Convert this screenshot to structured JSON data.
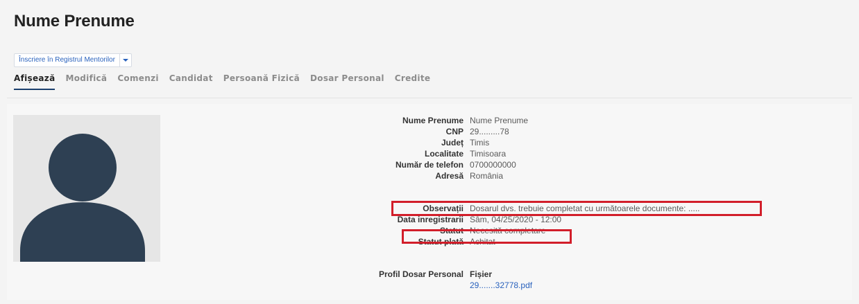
{
  "page": {
    "title": "Nume Prenume"
  },
  "actions": {
    "primary_label": "Înscriere în Registrul Mentorilor"
  },
  "tabs": [
    {
      "label": "Afișează",
      "active": true
    },
    {
      "label": "Modifică",
      "active": false
    },
    {
      "label": "Comenzi",
      "active": false
    },
    {
      "label": "Candidat",
      "active": false
    },
    {
      "label": "Persoană Fizică",
      "active": false
    },
    {
      "label": "Dosar Personal",
      "active": false
    },
    {
      "label": "Credite",
      "active": false
    }
  ],
  "profile": {
    "avatar_icon": "user-silhouette-icon",
    "fields": [
      {
        "label": "Nume Prenume",
        "value": "Nume Prenume"
      },
      {
        "label": "CNP",
        "value": "29.........78"
      },
      {
        "label": "Județ",
        "value": "Timis"
      },
      {
        "label": "Localitate",
        "value": "Timisoara"
      },
      {
        "label": "Număr de telefon",
        "value": "0700000000"
      },
      {
        "label": "Adresă",
        "value": "România"
      }
    ],
    "status_fields": [
      {
        "label": "Observații",
        "value": "Dosarul dvs. trebuie completat cu următoarele documente: ....."
      },
      {
        "label": "Data inregistrarii",
        "value": "Sâm, 04/25/2020 - 12:00"
      },
      {
        "label": "Statut",
        "value": "Necesită completare"
      },
      {
        "label": "Statut plată",
        "value": "Achitat"
      }
    ],
    "dossier": {
      "label": "Profil Dosar Personal",
      "column_header": "Fișier",
      "file_name": "29.......32778.pdf"
    }
  },
  "colors": {
    "accent": "#2a62bd",
    "highlight": "#d21e2a",
    "avatar": "#2e4053",
    "tab_underline": "#1b3f6e"
  }
}
